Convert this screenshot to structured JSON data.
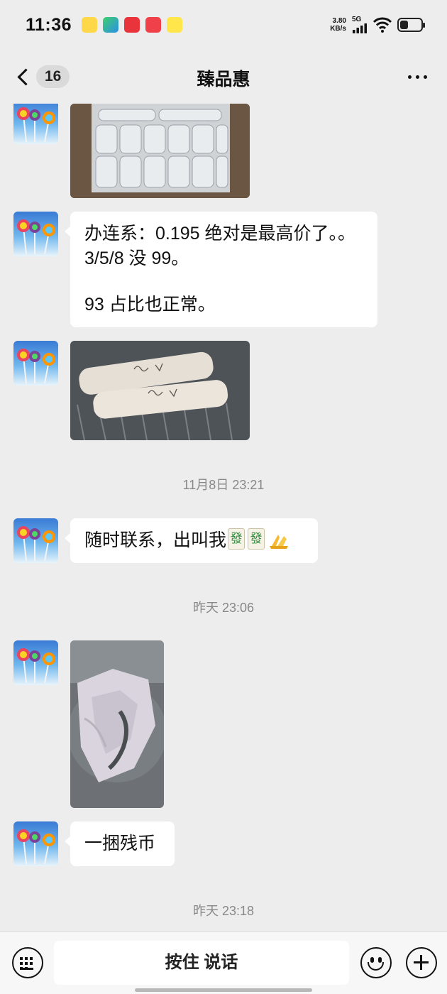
{
  "status_bar": {
    "time": "11:36",
    "net_speed_value": "3.80",
    "net_speed_unit": "KB/s",
    "network": "5G",
    "icons": [
      "app-icon-yellow",
      "app-icon-video",
      "app-icon-red",
      "app-icon-heart",
      "app-icon-news",
      "signal-icon",
      "wifi-icon",
      "battery-icon"
    ]
  },
  "nav": {
    "back_count": "16",
    "title": "臻品惠",
    "icons": [
      "back-chevron-icon",
      "more-icon"
    ]
  },
  "messages": [
    {
      "type": "image",
      "description_icon": "photo-icon"
    },
    {
      "type": "text",
      "lines": [
        "办连系：0.195 绝对是最高价了。。",
        "3/5/8 没 99。",
        "",
        "93 占比也正常。"
      ]
    },
    {
      "type": "image",
      "description_icon": "photo-icon"
    },
    {
      "type": "time",
      "text": "11月8日 23:21"
    },
    {
      "type": "text",
      "text": "随时联系，出叫我",
      "emoji": [
        "mahjong-fa-icon",
        "mahjong-fa-icon",
        "folded-hands-icon"
      ]
    },
    {
      "type": "time",
      "text": "昨天 23:06"
    },
    {
      "type": "image",
      "description_icon": "photo-icon"
    },
    {
      "type": "text",
      "text": "一捆残币"
    },
    {
      "type": "time",
      "text": "昨天 23:18"
    }
  ],
  "input_bar": {
    "hold_to_talk": "按住 说话",
    "icons": [
      "keyboard-icon",
      "emoji-icon",
      "plus-icon"
    ]
  },
  "colors": {
    "background": "#ededed",
    "bubble": "#ffffff",
    "timestamp": "#888888"
  }
}
